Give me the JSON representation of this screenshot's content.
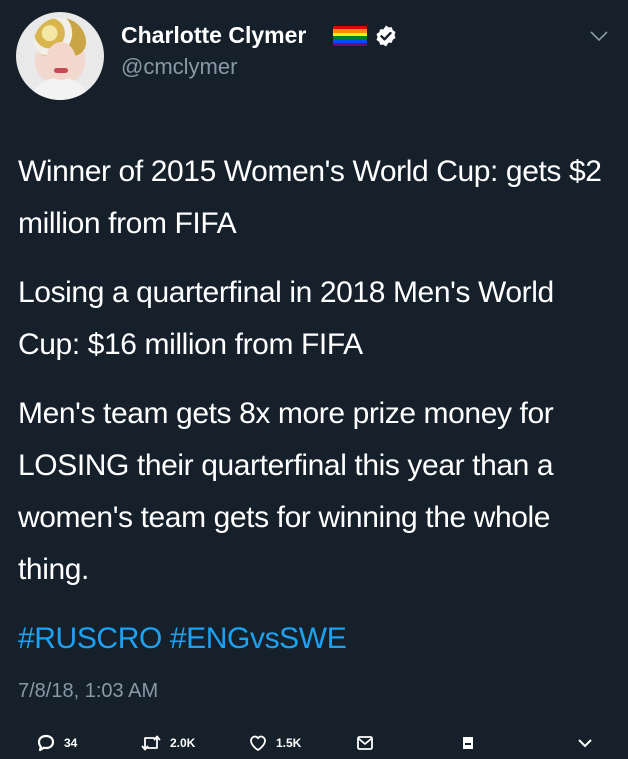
{
  "author": {
    "name": "Charlotte Clymer",
    "handle": "@cmclymer",
    "flag_colors": [
      "#e40303",
      "#ff8c00",
      "#ffed00",
      "#008026",
      "#004dff",
      "#750787"
    ]
  },
  "tweet": {
    "paragraphs": [
      "Winner of 2015 Women's World Cup: gets $2 million from FIFA",
      "Losing a quarterfinal in 2018 Men's World Cup: $16 million from FIFA",
      "Men's team gets 8x more prize money for LOSING their quarterfinal this year than a women's team gets for winning the whole thing."
    ],
    "hashtags": [
      "#RUSCRO",
      "#ENGvsSWE"
    ],
    "timestamp": "7/8/18, 1:03 AM"
  },
  "actions": {
    "reply_count": "34",
    "retweet_count": "2.0K",
    "like_count": "1.5K"
  },
  "colors": {
    "background": "#15202b",
    "text": "#ffffff",
    "secondary": "#8899a6",
    "link": "#1da1f2"
  },
  "icons": [
    "verified-badge-icon",
    "chevron-down-icon",
    "reply-icon",
    "retweet-icon",
    "like-icon",
    "message-icon",
    "bookmark-icon"
  ]
}
